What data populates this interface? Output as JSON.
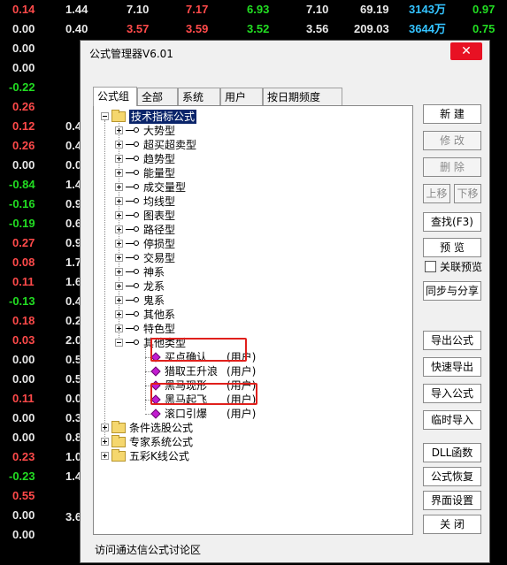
{
  "background_rows": [
    {
      "c0": "0.14",
      "c1": "1.44",
      "c2": "7.10",
      "c3": "7.17",
      "c4": "6.93",
      "c5": "7.10",
      "c6": "69.19",
      "c7": "3143万",
      "c8": "0.97",
      "col0": "red",
      "col3": "red",
      "col4": "green"
    },
    {
      "c0": "0.00",
      "c1": "0.40",
      "c2": "3.57",
      "c3": "3.59",
      "c4": "3.52",
      "c5": "3.56",
      "c6": "209.03",
      "c7": "3644万",
      "c8": "0.75",
      "col0": "white",
      "col2": "red",
      "col3": "red",
      "col4": "green"
    },
    {
      "c0": "0.00",
      "c1": "",
      "col0": "white"
    },
    {
      "c0": "0.00",
      "col0": "white"
    },
    {
      "c0": "-0.22",
      "col0": "green"
    },
    {
      "c0": "0.26",
      "col0": "red"
    },
    {
      "c0": "0.12",
      "col0": "red"
    },
    {
      "c0": "0.26",
      "col0": "red"
    },
    {
      "c0": "0.00",
      "col0": "white"
    },
    {
      "c0": "-0.84",
      "col0": "green"
    },
    {
      "c0": "-0.16",
      "col0": "green"
    },
    {
      "c0": "-0.19",
      "col0": "green"
    },
    {
      "c0": "0.27",
      "col0": "red"
    },
    {
      "c0": "0.08",
      "col0": "red"
    },
    {
      "c0": "0.11",
      "col0": "red"
    },
    {
      "c0": "-0.13",
      "col0": "green"
    },
    {
      "c0": "0.18",
      "col0": "red"
    },
    {
      "c0": "0.03",
      "col0": "red"
    },
    {
      "c0": "0.00",
      "col0": "white"
    },
    {
      "c0": "0.00",
      "col0": "white"
    },
    {
      "c0": "0.11",
      "col0": "red"
    },
    {
      "c0": "0.00",
      "col0": "white"
    },
    {
      "c0": "0.00",
      "col0": "white"
    },
    {
      "c0": "0.23",
      "col0": "red"
    },
    {
      "c0": "-0.23",
      "col0": "green"
    },
    {
      "c0": "0.55",
      "c1": "3.6",
      "col0": "red"
    },
    {
      "c0": "0.00",
      "col0": "white"
    },
    {
      "c0": "0.00",
      "col0": "white"
    }
  ],
  "side_values": [
    "0.4",
    "0.4",
    "0.0",
    "1.4",
    "0.9",
    "0.6",
    "0.9",
    "1.7",
    "1.6",
    "0.4",
    "0.2",
    "2.0",
    "0.5",
    "0.5",
    "0.0",
    "0.3",
    "0.8",
    "1.0",
    "1.4"
  ],
  "dialog": {
    "title": "公式管理器V6.01",
    "close_label": "✕",
    "tabs": [
      "公式组",
      "全部",
      "系统",
      "用户",
      "按日期频度"
    ],
    "tree": {
      "root": "技术指标公式",
      "groups": [
        "大势型",
        "超买超卖型",
        "趋势型",
        "能量型",
        "成交量型",
        "均线型",
        "图表型",
        "路径型",
        "停损型",
        "交易型",
        "神系",
        "龙系",
        "鬼系",
        "其他系",
        "特色型",
        "其他类型"
      ],
      "children": [
        {
          "name": "买点确认",
          "tag": "(用户)"
        },
        {
          "name": "猎取王升浪",
          "tag": "(用户)"
        },
        {
          "name": "黑马现形",
          "tag": "(用户)"
        },
        {
          "name": "黑马起飞",
          "tag": "(用户)"
        },
        {
          "name": "滚口引爆",
          "tag": "(用户)"
        }
      ],
      "roots2": [
        "条件选股公式",
        "专家系统公式",
        "五彩K线公式"
      ]
    },
    "buttons": {
      "new": "新 建",
      "modify": "修 改",
      "delete": "删 除",
      "up": "上移",
      "down": "下移",
      "find": "查找(F3)",
      "preview": "预 览",
      "link_preview": "关联预览",
      "sync_share": "同步与分享",
      "export": "导出公式",
      "quick_export": "快速导出",
      "import": "导入公式",
      "temp_import": "临时导入",
      "dll": "DLL函数",
      "restore": "公式恢复",
      "ui_settings": "界面设置",
      "close": "关 闭"
    },
    "footer": "访问通达信公式讨论区"
  }
}
